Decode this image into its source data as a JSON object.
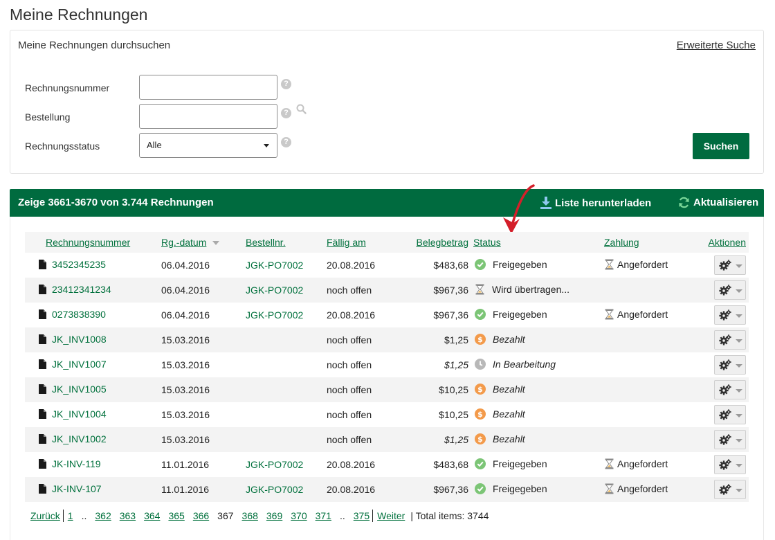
{
  "page_title": "Meine Rechnungen",
  "search": {
    "heading": "Meine Rechnungen durchsuchen",
    "advanced_link": "Erweiterte Suche",
    "invoice_number_label": "Rechnungsnummer",
    "invoice_number_value": "",
    "order_label": "Bestellung",
    "order_value": "",
    "status_label": "Rechnungsstatus",
    "status_value": "Alle",
    "help_glyph": "?",
    "search_button": "Suchen"
  },
  "results": {
    "summary": "Zeige 3661-3670 von 3.744 Rechnungen",
    "download_label": "Liste herunterladen",
    "refresh_label": "Aktualisieren",
    "accent_color": "#006b3f",
    "columns": [
      "Rechnungsnummer",
      "Rg.-datum",
      "Bestellnr.",
      "Fällig am",
      "Belegbetrag",
      "Status",
      "Zahlung",
      "Aktionen"
    ],
    "rows": [
      {
        "invoice": "3452345235",
        "date": "06.04.2016",
        "po": "JGK-PO7002",
        "due": "20.08.2016",
        "amount": "$483,68",
        "amount_italic": false,
        "status_icon": "check-circle-icon",
        "status": "Freigegeben",
        "status_italic": false,
        "payment_icon": "hourglass-icon",
        "payment": "Angefordert"
      },
      {
        "invoice": "23412341234",
        "date": "06.04.2016",
        "po": "JGK-PO7002",
        "due": "noch offen",
        "amount": "$967,36",
        "amount_italic": false,
        "status_icon": "hourglass-icon",
        "status": "Wird übertragen...",
        "status_italic": false,
        "payment_icon": "",
        "payment": ""
      },
      {
        "invoice": "0273838390",
        "date": "06.04.2016",
        "po": "JGK-PO7002",
        "due": "20.08.2016",
        "amount": "$967,36",
        "amount_italic": false,
        "status_icon": "check-circle-icon",
        "status": "Freigegeben",
        "status_italic": false,
        "payment_icon": "hourglass-icon",
        "payment": "Angefordert"
      },
      {
        "invoice": "JK_INV1008",
        "date": "15.03.2016",
        "po": "",
        "due": "noch offen",
        "amount": "$1,25",
        "amount_italic": false,
        "status_icon": "dollar-coin-icon",
        "status": "Bezahlt",
        "status_italic": true,
        "payment_icon": "",
        "payment": ""
      },
      {
        "invoice": "JK_INV1007",
        "date": "15.03.2016",
        "po": "",
        "due": "noch offen",
        "amount": "$1,25",
        "amount_italic": true,
        "status_icon": "clock-icon",
        "status": "In Bearbeitung",
        "status_italic": true,
        "payment_icon": "",
        "payment": ""
      },
      {
        "invoice": "JK_INV1005",
        "date": "15.03.2016",
        "po": "",
        "due": "noch offen",
        "amount": "$10,25",
        "amount_italic": false,
        "status_icon": "dollar-coin-icon",
        "status": "Bezahlt",
        "status_italic": true,
        "payment_icon": "",
        "payment": ""
      },
      {
        "invoice": "JK_INV1004",
        "date": "15.03.2016",
        "po": "",
        "due": "noch offen",
        "amount": "$10,25",
        "amount_italic": false,
        "status_icon": "dollar-coin-icon",
        "status": "Bezahlt",
        "status_italic": true,
        "payment_icon": "",
        "payment": ""
      },
      {
        "invoice": "JK_INV1002",
        "date": "15.03.2016",
        "po": "",
        "due": "noch offen",
        "amount": "$1,25",
        "amount_italic": true,
        "status_icon": "dollar-coin-icon",
        "status": "Bezahlt",
        "status_italic": true,
        "payment_icon": "",
        "payment": ""
      },
      {
        "invoice": "JK-INV-119",
        "date": "11.01.2016",
        "po": "JGK-PO7002",
        "due": "20.08.2016",
        "amount": "$483,68",
        "amount_italic": false,
        "status_icon": "check-circle-icon",
        "status": "Freigegeben",
        "status_italic": false,
        "payment_icon": "hourglass-icon",
        "payment": "Angefordert"
      },
      {
        "invoice": "JK-INV-107",
        "date": "11.01.2016",
        "po": "JGK-PO7002",
        "due": "20.08.2016",
        "amount": "$967,36",
        "amount_italic": false,
        "status_icon": "check-circle-icon",
        "status": "Freigegeben",
        "status_italic": false,
        "payment_icon": "hourglass-icon",
        "payment": "Angefordert"
      }
    ]
  },
  "pagination": {
    "prev": "Zurück",
    "first": "1",
    "ellipsis": "..",
    "pages": [
      "362",
      "363",
      "364",
      "365",
      "366",
      "367",
      "368",
      "369",
      "370",
      "371"
    ],
    "current": "367",
    "last": "375",
    "next": "Weiter",
    "total": "| Total items: 3744"
  }
}
